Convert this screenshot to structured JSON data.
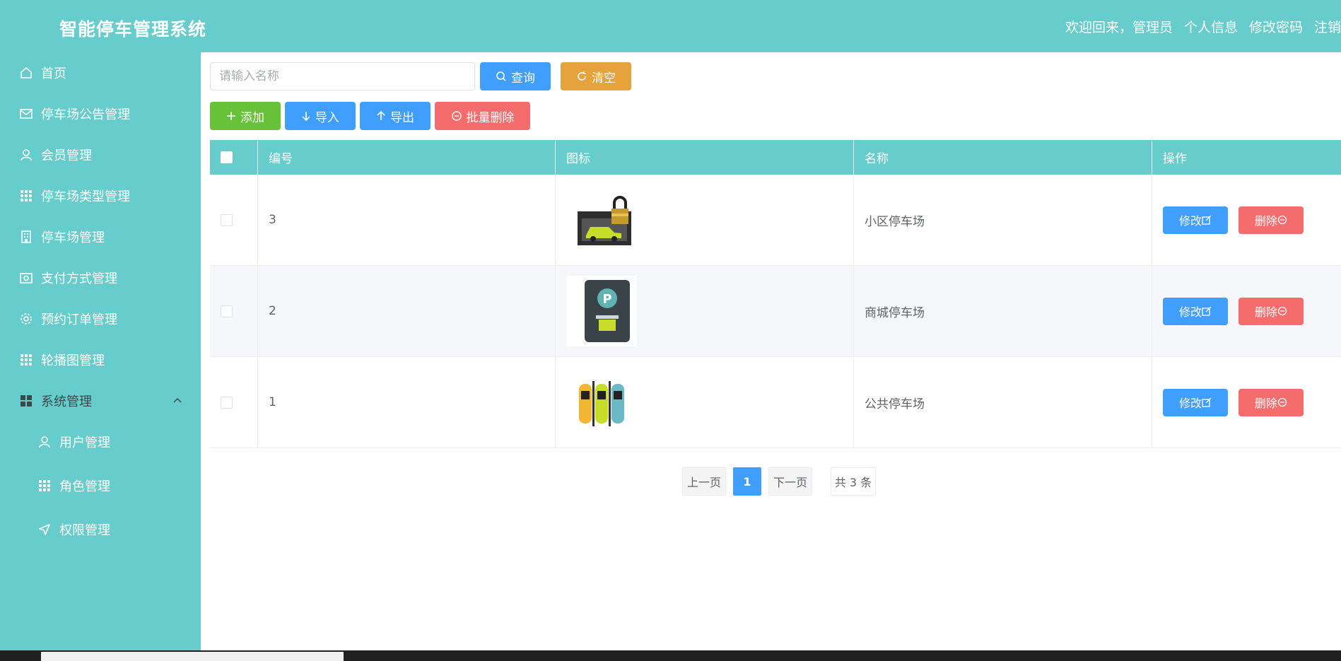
{
  "header": {
    "title": "智能停车管理系统",
    "welcome": "欢迎回来，管理员",
    "profile": "个人信息",
    "change_password": "修改密码",
    "logout": "注销"
  },
  "sidebar": {
    "items": [
      {
        "label": "首页",
        "icon": "home-icon"
      },
      {
        "label": "停车场公告管理",
        "icon": "mail-icon"
      },
      {
        "label": "会员管理",
        "icon": "user-icon"
      },
      {
        "label": "停车场类型管理",
        "icon": "grid-icon"
      },
      {
        "label": "停车场管理",
        "icon": "building-icon"
      },
      {
        "label": "支付方式管理",
        "icon": "wallet-icon"
      },
      {
        "label": "预约订单管理",
        "icon": "gear-icon"
      },
      {
        "label": "轮播图管理",
        "icon": "grid-icon"
      },
      {
        "label": "系统管理",
        "icon": "apps-icon"
      }
    ],
    "sub_items": [
      {
        "label": "用户管理",
        "icon": "user-icon"
      },
      {
        "label": "角色管理",
        "icon": "grid-icon"
      },
      {
        "label": "权限管理",
        "icon": "send-icon"
      }
    ]
  },
  "search": {
    "placeholder": "请输入名称",
    "query_label": "查询",
    "clear_label": "清空"
  },
  "toolbar": {
    "add_label": "添加",
    "import_label": "导入",
    "export_label": "导出",
    "batch_delete_label": "批量删除"
  },
  "table": {
    "columns": [
      "编号",
      "图标",
      "名称",
      "操作"
    ],
    "rows": [
      {
        "id": "3",
        "icon": "parking-lock-car-image",
        "name": "小区停车场",
        "edit_label": "修改",
        "delete_label": "删除"
      },
      {
        "id": "2",
        "icon": "parking-meter-image",
        "name": "商城停车场",
        "edit_label": "修改",
        "delete_label": "删除"
      },
      {
        "id": "1",
        "icon": "three-cars-image",
        "name": "公共停车场",
        "edit_label": "修改",
        "delete_label": "删除"
      }
    ]
  },
  "pagination": {
    "prev": "上一页",
    "current": "1",
    "next": "下一页",
    "total": "共 3 条"
  },
  "colors": {
    "brand": "#66cdcc",
    "primary": "#409eff",
    "warning": "#e6a23c",
    "success": "#67c23a",
    "danger": "#f56c6c"
  }
}
